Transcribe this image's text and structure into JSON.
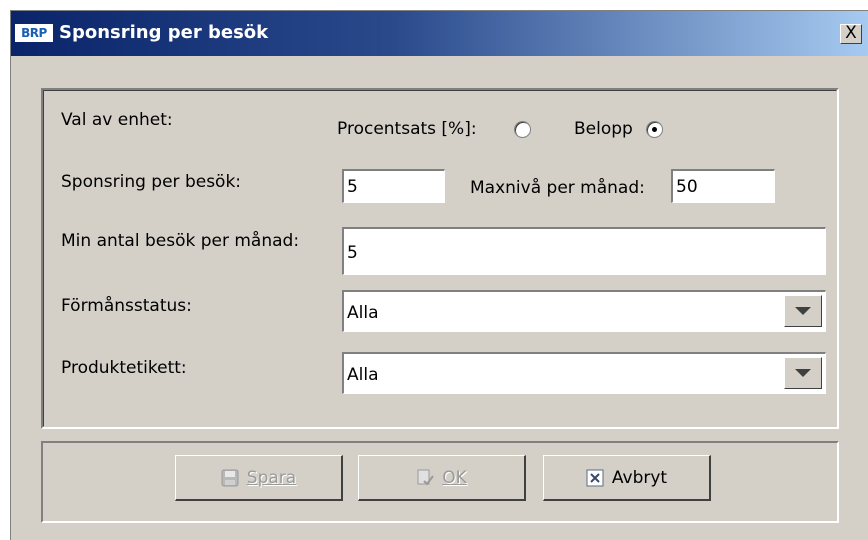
{
  "window": {
    "title": "Sponsring per besök",
    "logo_text": "BRP",
    "close_label": "X"
  },
  "form": {
    "unit_label": "Val av enhet:",
    "percent_label": "Procentsats [%]:",
    "percent_selected": false,
    "amount_label": "Belopp",
    "amount_selected": true,
    "sponsorship_label": "Sponsring per besök:",
    "sponsorship_value": "5",
    "max_level_label": "Maxnivå per månad:",
    "max_level_value": "50",
    "min_visits_label": "Min antal besök per månad:",
    "min_visits_value": "5",
    "benefit_status_label": "Förmånsstatus:",
    "benefit_status_value": "Alla",
    "product_tag_label": "Produktetikett:",
    "product_tag_value": "Alla"
  },
  "buttons": {
    "save_label": "Spara",
    "ok_label": "OK",
    "cancel_label": "Avbryt"
  },
  "icons": {
    "app": "brp-logo-icon",
    "close": "close-icon",
    "save": "floppy-disk-icon",
    "ok": "document-check-icon",
    "cancel": "cancel-x-icon",
    "dropdown": "chevron-down-icon"
  }
}
